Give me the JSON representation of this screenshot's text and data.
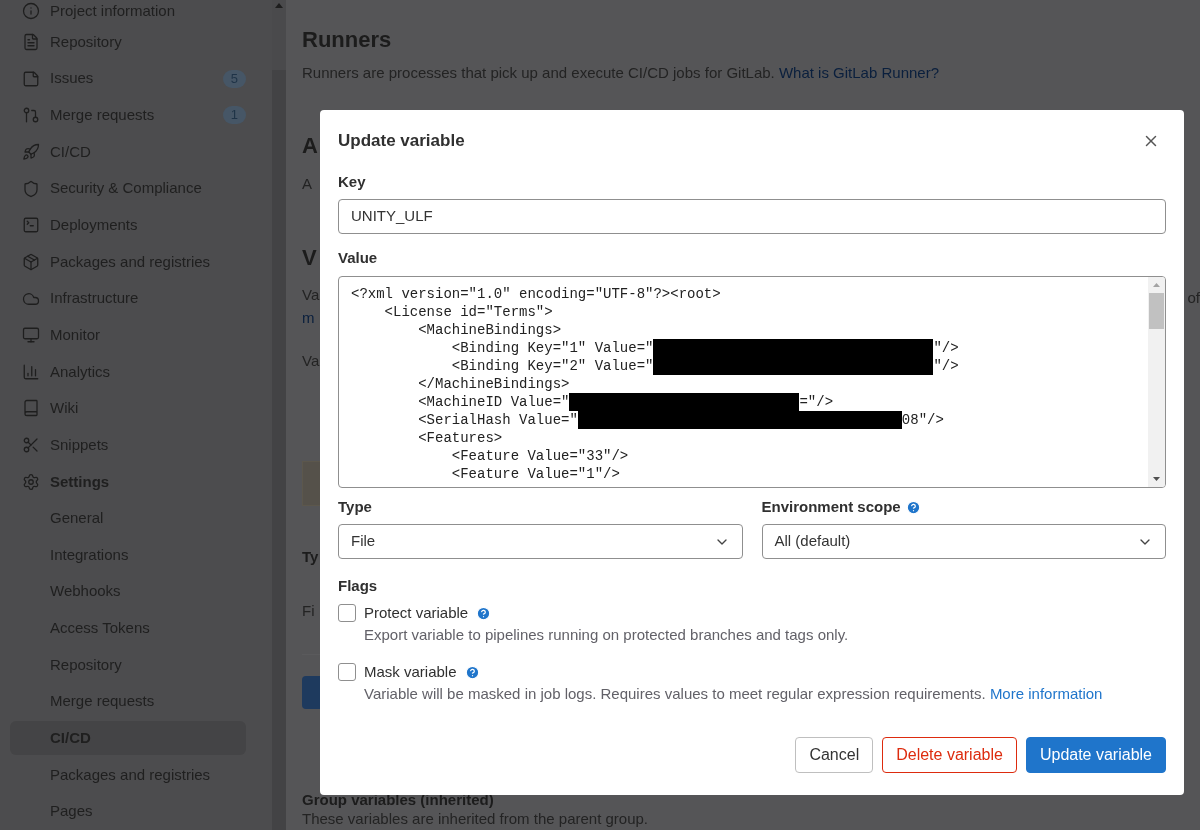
{
  "sidebar": {
    "items": [
      {
        "label": "Project information"
      },
      {
        "label": "Repository"
      },
      {
        "label": "Issues",
        "badge": "5"
      },
      {
        "label": "Merge requests",
        "badge": "1"
      },
      {
        "label": "CI/CD"
      },
      {
        "label": "Security & Compliance"
      },
      {
        "label": "Deployments"
      },
      {
        "label": "Packages and registries"
      },
      {
        "label": "Infrastructure"
      },
      {
        "label": "Monitor"
      },
      {
        "label": "Analytics"
      },
      {
        "label": "Wiki"
      },
      {
        "label": "Snippets"
      },
      {
        "label": "Settings",
        "expanded": true,
        "children": [
          {
            "label": "General",
            "selected": false
          },
          {
            "label": "Integrations",
            "selected": false
          },
          {
            "label": "Webhooks",
            "selected": false
          },
          {
            "label": "Access Tokens",
            "selected": false
          },
          {
            "label": "Repository",
            "selected": false
          },
          {
            "label": "Merge requests",
            "selected": false
          },
          {
            "label": "CI/CD",
            "selected": true
          },
          {
            "label": "Packages and registries",
            "selected": false
          },
          {
            "label": "Pages",
            "selected": false
          }
        ]
      }
    ]
  },
  "page": {
    "title": "Runners",
    "description": "Runners are processes that pick up and execute CI/CD jobs for GitLab.",
    "link": "What is GitLab Runner?",
    "covered": [
      {
        "kind": "heading",
        "text": "A"
      },
      {
        "kind": "text",
        "text": "A"
      },
      {
        "kind": "heading",
        "text": "V"
      },
      {
        "kind": "text",
        "text": "Va"
      },
      {
        "kind": "link",
        "text": "m"
      },
      {
        "kind": "text",
        "text": "Va"
      },
      {
        "kind": "alert"
      },
      {
        "kind": "label",
        "text": "Ty"
      },
      {
        "kind": "text",
        "text": "Fi"
      },
      {
        "kind": "divider"
      },
      {
        "kind": "button"
      },
      {
        "kind": "label",
        "text": "Group variables (inherited)"
      },
      {
        "kind": "text",
        "text": "These variables are inherited from the parent group."
      }
    ],
    "right_edge_text": "of"
  },
  "dialog": {
    "title": "Update variable",
    "key": {
      "label": "Key",
      "value": "UNITY_ULF"
    },
    "value": {
      "label": "Value",
      "lines": [
        [
          {
            "kind": "text",
            "text": "<?xml version=\"1.0\" encoding=\"UTF-8\"?><root>"
          }
        ],
        [
          {
            "kind": "text",
            "text": "    <License id=\"Terms\">"
          }
        ],
        [
          {
            "kind": "text",
            "text": "        <MachineBindings>"
          }
        ],
        [
          {
            "kind": "text",
            "text": "            <Binding Key=\"1\" Value=\""
          },
          {
            "kind": "redacted"
          },
          {
            "kind": "text",
            "text": "\"/>"
          }
        ],
        [
          {
            "kind": "text",
            "text": "            <Binding Key=\"2\" Value=\""
          },
          {
            "kind": "redacted"
          },
          {
            "kind": "text",
            "text": "\"/>"
          }
        ],
        [
          {
            "kind": "text",
            "text": "        </MachineBindings>"
          }
        ],
        [
          {
            "kind": "text",
            "text": "        <MachineID Value=\""
          },
          {
            "kind": "redacted"
          },
          {
            "kind": "text",
            "text": "=\"/>"
          }
        ],
        [
          {
            "kind": "text",
            "text": "        <SerialHash Value=\""
          },
          {
            "kind": "redacted"
          },
          {
            "kind": "text",
            "text": "08\"/>"
          }
        ],
        [
          {
            "kind": "text",
            "text": "        <Features>"
          }
        ],
        [
          {
            "kind": "text",
            "text": "            <Feature Value=\"33\"/>"
          }
        ],
        [
          {
            "kind": "text",
            "text": "            <Feature Value=\"1\"/>"
          }
        ]
      ]
    },
    "type": {
      "label": "Type",
      "value": "File"
    },
    "environment_scope": {
      "label": "Environment scope",
      "value": "All (default)"
    },
    "flags": {
      "label": "Flags",
      "options": [
        {
          "label": "Protect variable",
          "checked": false,
          "description": "Export variable to pipelines running on protected branches and tags only."
        },
        {
          "label": "Mask variable",
          "checked": false,
          "description": "Variable will be masked in job logs. Requires values to meet regular expression requirements.",
          "link": "More information"
        }
      ]
    },
    "buttons": [
      {
        "label": "Cancel",
        "kind": "default"
      },
      {
        "label": "Delete variable",
        "kind": "danger"
      },
      {
        "label": "Update variable",
        "kind": "primary"
      }
    ]
  }
}
